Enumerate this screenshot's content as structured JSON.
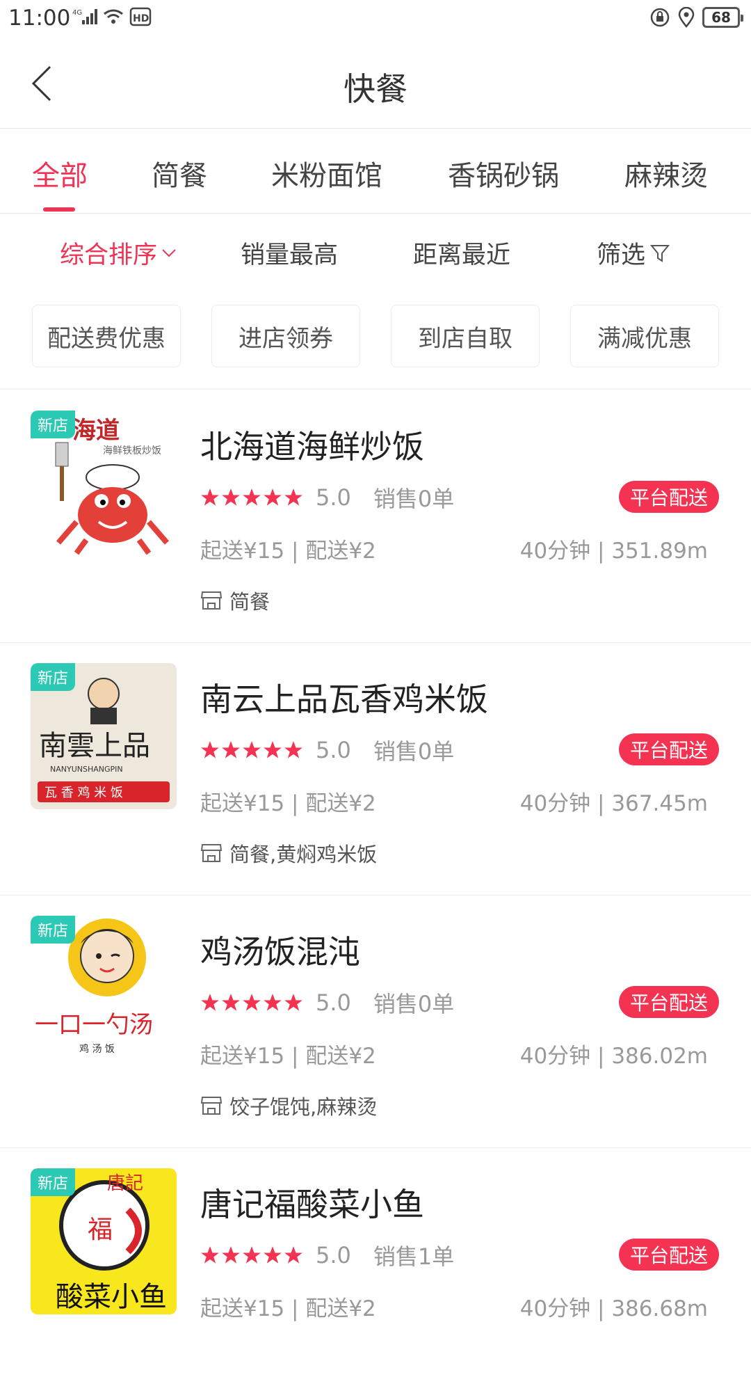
{
  "status": {
    "time": "11:00",
    "network": "4G",
    "hd": "HD",
    "battery": "68"
  },
  "nav": {
    "title": "快餐"
  },
  "tabs": [
    {
      "label": "全部",
      "active": true
    },
    {
      "label": "简餐"
    },
    {
      "label": "米粉面馆"
    },
    {
      "label": "香锅砂锅"
    },
    {
      "label": "麻辣烫"
    }
  ],
  "sort": [
    {
      "label": "综合排序",
      "active": true
    },
    {
      "label": "销量最高"
    },
    {
      "label": "距离最近"
    },
    {
      "label": "筛选"
    }
  ],
  "chips": [
    "配送费优惠",
    "进店领券",
    "到店自取",
    "满减优惠"
  ],
  "colors": {
    "accent": "#ee3355",
    "badge_new": "#2cc9b5",
    "platform_badge": "#f33351"
  },
  "shops": [
    {
      "badge": "新店",
      "name": "北海道海鲜炒饭",
      "stars": 5,
      "score": "5.0",
      "sales": "销售0单",
      "delivery": "平台配送",
      "fees": "起送¥15 | 配送¥2",
      "eta": "40分钟 | 351.89m",
      "category": "简餐",
      "logo_text": "海道",
      "logo_sub": "海鲜铁板炒饭"
    },
    {
      "badge": "新店",
      "name": "南云上品瓦香鸡米饭",
      "stars": 5,
      "score": "5.0",
      "sales": "销售0单",
      "delivery": "平台配送",
      "fees": "起送¥15 | 配送¥2",
      "eta": "40分钟 | 367.45m",
      "category": "简餐,黄焖鸡米饭",
      "logo_text": "南雲上品",
      "logo_sub": "NANYUNSHANGPIN",
      "logo_sub2": "瓦 香 鸡 米 饭"
    },
    {
      "badge": "新店",
      "name": "鸡汤饭混沌",
      "stars": 5,
      "score": "5.0",
      "sales": "销售0单",
      "delivery": "平台配送",
      "fees": "起送¥15 | 配送¥2",
      "eta": "40分钟 | 386.02m",
      "category": "饺子馄饨,麻辣烫",
      "logo_text": "一口一勺汤",
      "logo_sub": "鸡 汤 饭"
    },
    {
      "badge": "新店",
      "name": "唐记福酸菜小鱼",
      "stars": 5,
      "score": "5.0",
      "sales": "销售1单",
      "delivery": "平台配送",
      "fees": "起送¥15 | 配送¥2",
      "eta": "40分钟 | 386.68m",
      "category": "",
      "logo_text": "唐記",
      "logo_mid": "福",
      "logo_sub": "酸菜小鱼"
    }
  ]
}
